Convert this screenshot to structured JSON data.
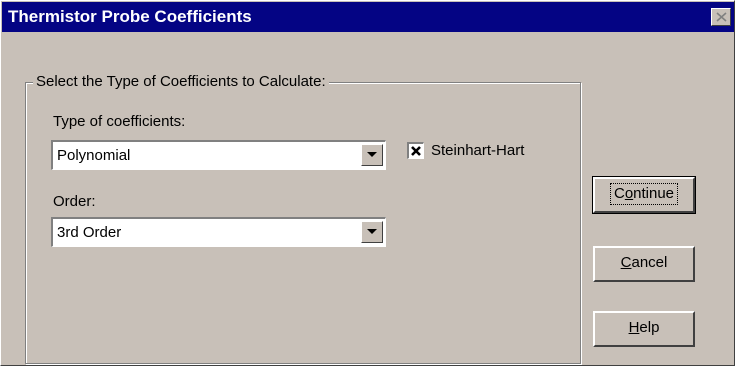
{
  "window": {
    "title": "Thermistor Probe Coefficients"
  },
  "group": {
    "legend": "Select the Type of Coefficients to Calculate:"
  },
  "type_field": {
    "label": "Type of coefficients:",
    "value": "Polynomial"
  },
  "order_field": {
    "label": "Order:",
    "value": "3rd Order"
  },
  "steinhart": {
    "label": "Steinhart-Hart",
    "checked": true
  },
  "buttons": {
    "continue": "Continue",
    "cancel": "Cancel",
    "help": "Help"
  },
  "colors": {
    "titlebar": "#040484",
    "face": "#c8c0b8"
  }
}
